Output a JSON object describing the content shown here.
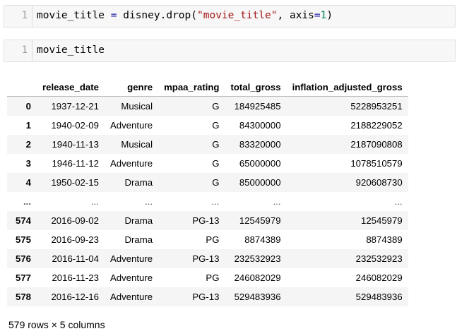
{
  "cells": [
    {
      "line_number": "1",
      "code_tokens": [
        {
          "text": "movie_title ",
          "cls": ""
        },
        {
          "text": "=",
          "cls": "tok-op"
        },
        {
          "text": " disney.drop(",
          "cls": ""
        },
        {
          "text": "\"movie_title\"",
          "cls": "tok-str"
        },
        {
          "text": ", axis",
          "cls": ""
        },
        {
          "text": "=",
          "cls": "tok-op"
        },
        {
          "text": "1",
          "cls": "tok-num"
        },
        {
          "text": ")",
          "cls": ""
        }
      ]
    },
    {
      "line_number": "1",
      "code_tokens": [
        {
          "text": "movie_title",
          "cls": ""
        }
      ]
    }
  ],
  "table": {
    "columns": [
      "",
      "release_date",
      "genre",
      "mpaa_rating",
      "total_gross",
      "inflation_adjusted_gross"
    ],
    "rows": [
      [
        "0",
        "1937-12-21",
        "Musical",
        "G",
        "184925485",
        "5228953251"
      ],
      [
        "1",
        "1940-02-09",
        "Adventure",
        "G",
        "84300000",
        "2188229052"
      ],
      [
        "2",
        "1940-11-13",
        "Musical",
        "G",
        "83320000",
        "2187090808"
      ],
      [
        "3",
        "1946-11-12",
        "Adventure",
        "G",
        "65000000",
        "1078510579"
      ],
      [
        "4",
        "1950-02-15",
        "Drama",
        "G",
        "85000000",
        "920608730"
      ],
      [
        "...",
        "...",
        "...",
        "...",
        "...",
        "..."
      ],
      [
        "574",
        "2016-09-02",
        "Drama",
        "PG-13",
        "12545979",
        "12545979"
      ],
      [
        "575",
        "2016-09-23",
        "Drama",
        "PG",
        "8874389",
        "8874389"
      ],
      [
        "576",
        "2016-11-04",
        "Adventure",
        "PG-13",
        "232532923",
        "232532923"
      ],
      [
        "577",
        "2016-11-23",
        "Adventure",
        "PG",
        "246082029",
        "246082029"
      ],
      [
        "578",
        "2016-12-16",
        "Adventure",
        "PG-13",
        "529483936",
        "529483936"
      ]
    ]
  },
  "footer": "579 rows × 5 columns"
}
